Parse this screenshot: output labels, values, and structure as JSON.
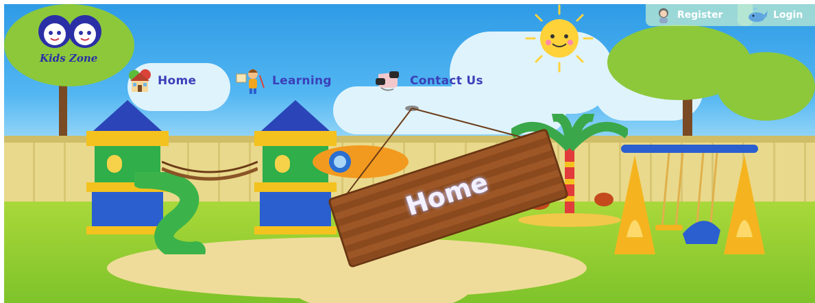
{
  "logo": {
    "text": "Kids Zone"
  },
  "nav": {
    "items": [
      {
        "label": "Home",
        "icon": "house-icon"
      },
      {
        "label": "Learning",
        "icon": "kid-drawing-icon"
      },
      {
        "label": "Contact Us",
        "icon": "phone-icon"
      }
    ]
  },
  "auth": {
    "register_label": "Register",
    "login_label": "Login"
  },
  "hero": {
    "sign_text": "Home"
  },
  "colors": {
    "nav_text": "#3b3fb8",
    "sky": "#52b6f2",
    "grass": "#8cc83a",
    "sign_wood": "#8b4a1e"
  }
}
